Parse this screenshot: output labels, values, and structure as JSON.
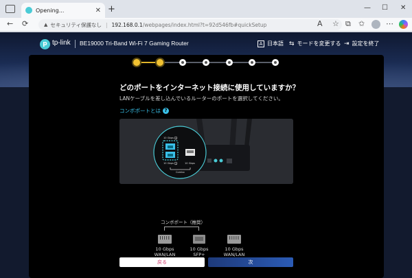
{
  "browser": {
    "tab_title": "Opening...",
    "tab_close": "✕",
    "new_tab": "+",
    "win_minimize": "—",
    "win_maximize": "☐",
    "win_close": "✕",
    "security_label": "セキュリティ保護なし",
    "url": "192.168.0.1",
    "url_rest": "/webpages/index.html?t=92d546fb#quickSetup",
    "icons": {
      "back": "←",
      "refresh": "⟳",
      "warning": "▲",
      "reader": "A",
      "favorite": "☆",
      "collections": "⧉",
      "favorites_bar": "✩",
      "more": "⋯"
    }
  },
  "header": {
    "logo_letter": "p",
    "brand": "tp-link",
    "model": "BE19000 Tri-Band Wi-Fi 7 Gaming Router",
    "language_icon": "A",
    "language": "日本語",
    "mode_icon": "⇆",
    "mode": "モードを変更する",
    "exit_icon": "⇥",
    "exit": "設定を終了"
  },
  "stepper": {
    "total_steps": 7,
    "completed_steps": 2
  },
  "content": {
    "title": "どのポートをインターネット接続に使用していますか？",
    "subtitle": "LANケーブルを差し込んでいるルーターのポートを選択してください。",
    "combo_link": "コンボポートとは",
    "help_icon": "?",
    "diagram": {
      "port_label_top": "10 Gbps",
      "port_label_bottom": "10 Gbps",
      "port_label_sfp": "10 Gbps",
      "combo_caption": "Combo",
      "badge_top": "2",
      "badge_bottom": "1"
    },
    "combo_section_label": "コンボポート（推奨）",
    "ports": [
      {
        "label": "10 Gbps\nWAN/LAN",
        "type": "ethernet",
        "selected": true
      },
      {
        "label": "10 Gbps\nSFP+",
        "type": "sfp",
        "selected": false
      },
      {
        "label": "10 Gbps\nWAN/LAN",
        "type": "ethernet",
        "selected": false
      }
    ],
    "back_button": "戻る",
    "next_button": "次"
  },
  "colors": {
    "accent": "#3ac0e8",
    "step_done": "#f2c231",
    "back_text": "#d0386a",
    "next_bg": "#2b5bb5"
  }
}
